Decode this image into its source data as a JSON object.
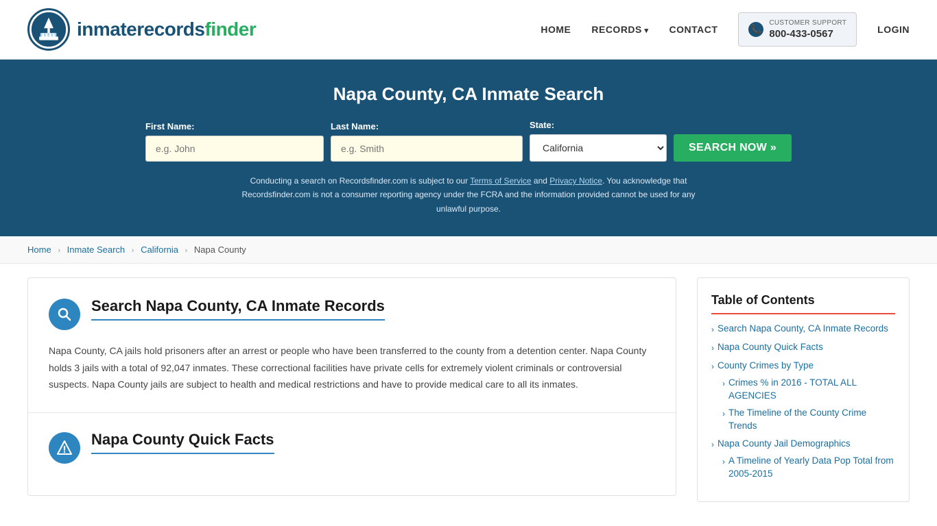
{
  "header": {
    "logo_text_main": "inmaterecords",
    "logo_text_bold": "finder",
    "nav_items": [
      {
        "label": "HOME",
        "has_arrow": false
      },
      {
        "label": "RECORDS",
        "has_arrow": true
      },
      {
        "label": "CONTACT",
        "has_arrow": false
      }
    ],
    "support": {
      "label": "CUSTOMER SUPPORT",
      "phone": "800-433-0567"
    },
    "login_label": "LOGIN"
  },
  "hero": {
    "title": "Napa County, CA Inmate Search",
    "first_name_label": "First Name:",
    "first_name_placeholder": "e.g. John",
    "last_name_label": "Last Name:",
    "last_name_placeholder": "e.g. Smith",
    "state_label": "State:",
    "state_value": "California",
    "search_btn": "SEARCH NOW »",
    "disclaimer": "Conducting a search on Recordsfinder.com is subject to our Terms of Service and Privacy Notice. You acknowledge that Recordsfinder.com is not a consumer reporting agency under the FCRA and the information provided cannot be used for any unlawful purpose."
  },
  "breadcrumb": {
    "items": [
      "Home",
      "Inmate Search",
      "California",
      "Napa County"
    ]
  },
  "main": {
    "section1": {
      "title": "Search Napa County, CA Inmate Records",
      "body": "Napa County, CA jails hold prisoners after an arrest or people who have been transferred to the county from a detention center. Napa County holds 3 jails with a total of 92,047 inmates. These correctional facilities have private cells for extremely violent criminals or controversial suspects. Napa County jails are subject to health and medical restrictions and have to provide medical care to all its inmates."
    },
    "section2": {
      "title": "Napa County Quick Facts"
    }
  },
  "toc": {
    "title": "Table of Contents",
    "items": [
      {
        "label": "Search Napa County, CA Inmate Records",
        "sub": []
      },
      {
        "label": "Napa County Quick Facts",
        "sub": []
      },
      {
        "label": "County Crimes by Type",
        "sub": [
          {
            "label": "Crimes % in 2016 - TOTAL ALL AGENCIES"
          },
          {
            "label": "The Timeline of the County Crime Trends"
          }
        ]
      },
      {
        "label": "Napa County Jail Demographics",
        "sub": [
          {
            "label": "A Timeline of Yearly Data Pop Total from 2005-2015"
          }
        ]
      }
    ]
  }
}
